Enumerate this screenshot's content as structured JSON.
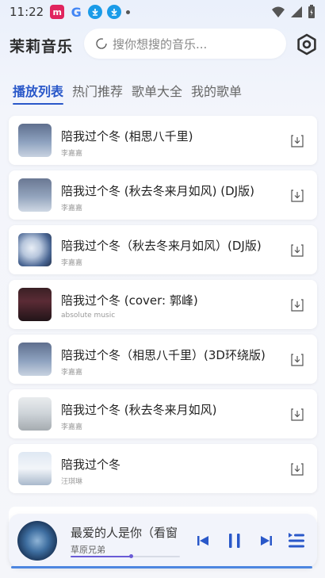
{
  "status_bar": {
    "time": "11:22",
    "icons_left": [
      "m-app-icon",
      "google-icon",
      "download-notify-icon",
      "download-notify-icon",
      "dot-icon"
    ],
    "icons_right": [
      "wifi-icon",
      "signal-icon",
      "battery-icon"
    ]
  },
  "header": {
    "app_title": "茉莉音乐",
    "search_placeholder": "搜你想搜的音乐...",
    "settings_icon": "gear-icon"
  },
  "tabs": [
    {
      "label": "播放列表",
      "active": true
    },
    {
      "label": "热门推荐",
      "active": false
    },
    {
      "label": "歌单大全",
      "active": false
    },
    {
      "label": "我的歌单",
      "active": false
    }
  ],
  "songs": [
    {
      "title": "陪我过个冬 (相思八千里)",
      "artist": "李嘉嘉"
    },
    {
      "title": "陪我过个冬 (秋去冬来月如风) (DJ版)",
      "artist": "李嘉嘉"
    },
    {
      "title": "陪我过个冬（秋去冬来月如风）(DJ版)",
      "artist": "李嘉嘉"
    },
    {
      "title": "陪我过个冬 (cover: 郭峰)",
      "artist": "absolute music"
    },
    {
      "title": "陪我过个冬（相思八千里）(3D环绕版)",
      "artist": "李嘉嘉"
    },
    {
      "title": "陪我过个冬 (秋去冬来月如风)",
      "artist": "李嘉嘉"
    },
    {
      "title": "陪我过个冬",
      "artist": "汪琪琳"
    }
  ],
  "player": {
    "title": "最爱的人是你（看窗",
    "artist": "草原兄弟",
    "progress_fraction": 0.55,
    "accent_color": "#6a5bd6"
  },
  "colors": {
    "accent": "#2a58c9",
    "download_icon": "#555555"
  }
}
